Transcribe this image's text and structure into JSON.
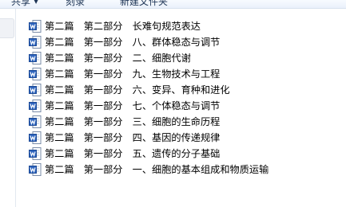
{
  "toolbar": {
    "share_label": "共享",
    "burn_label": "刻录",
    "new_folder_label": "新建文件夹"
  },
  "files": [
    {
      "name": "第二篇　第二部分　长难句规范表达",
      "icon": "word-doc-icon"
    },
    {
      "name": "第二篇　第一部分　八、群体稳态与调节",
      "icon": "word-doc-icon"
    },
    {
      "name": "第二篇　第一部分　二、细胞代谢",
      "icon": "word-doc-icon"
    },
    {
      "name": "第二篇　第一部分　九、生物技术与工程",
      "icon": "word-doc-icon"
    },
    {
      "name": "第二篇　第一部分　六、变异、育种和进化",
      "icon": "word-doc-icon"
    },
    {
      "name": "第二篇　第一部分　七、个体稳态与调节",
      "icon": "word-doc-icon"
    },
    {
      "name": "第二篇　第一部分　三、细胞的生命历程",
      "icon": "word-doc-icon"
    },
    {
      "name": "第二篇　第一部分　四、基因的传递规律",
      "icon": "word-doc-icon"
    },
    {
      "name": "第二篇　第一部分　五、遗传的分子基础",
      "icon": "word-doc-icon"
    },
    {
      "name": "第二篇　第一部分　一、细胞的基本组成和物质运输",
      "icon": "word-doc-icon"
    }
  ]
}
